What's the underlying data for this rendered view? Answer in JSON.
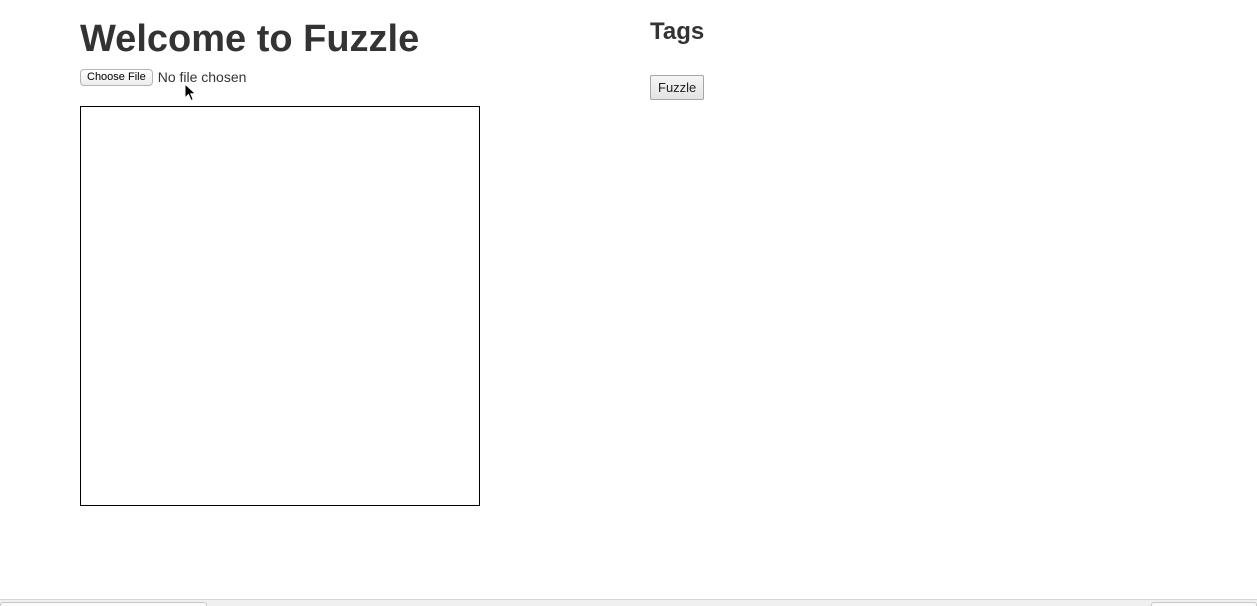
{
  "header": {
    "title": "Welcome to Fuzzle"
  },
  "upload": {
    "choose_file_label": "Choose File",
    "file_status": "No file chosen"
  },
  "sidebar": {
    "tags_heading": "Tags",
    "fuzzle_button_label": "Fuzzle"
  },
  "icons": {
    "cursor": "mouse-pointer-icon"
  },
  "colors": {
    "text": "#333333",
    "canvas_border": "#000000",
    "background": "#ffffff"
  }
}
